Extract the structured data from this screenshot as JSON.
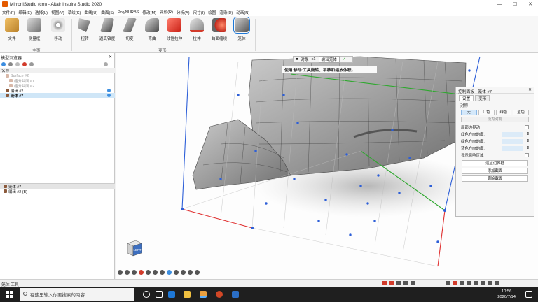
{
  "window": {
    "title": "Mirror.iStudio (cm) - Altair Inspire Studio 2020",
    "minimize": "—",
    "maximize": "☐",
    "close": "✕"
  },
  "menu": [
    "文件(F)",
    "编辑(E)",
    "选择(L)",
    "视图(V)",
    "草绘(K)",
    "曲线(U)",
    "曲面(S)",
    "PolyNURBS",
    "修改(M)",
    "变形(R)",
    "分析(A)",
    "尺寸(I)",
    "绘图",
    "渲染(D)",
    "动画(N)"
  ],
  "menu_active_index": 9,
  "ribbon": {
    "home_tools": [
      {
        "label": "文件",
        "icon": "file-icon"
      },
      {
        "label": "测量框",
        "icon": "measure-box-icon"
      },
      {
        "label": "移动",
        "icon": "move-icon"
      }
    ],
    "home_group": "主页",
    "deform_tools": [
      {
        "label": "扭转",
        "icon": "twist-icon"
      },
      {
        "label": "逼真锥度",
        "icon": "taper-icon"
      },
      {
        "label": "切变",
        "icon": "shear-icon"
      },
      {
        "label": "弯曲",
        "icon": "bend-icon"
      },
      {
        "label": "线性拉伸",
        "icon": "linear-stretch-icon"
      },
      {
        "label": "拉伸",
        "icon": "stretch-icon"
      },
      {
        "label": "曲面缠绕",
        "icon": "surface-wrap-icon"
      },
      {
        "label": "笼体",
        "icon": "cage-icon"
      }
    ],
    "deform_group": "变形"
  },
  "model_browser": {
    "title": "模型浏览器",
    "column": "名称",
    "tree": [
      {
        "label": "Surface #2",
        "muted": true,
        "indent": 1
      },
      {
        "label": "缩分曲面 #1",
        "muted": true,
        "indent": 2
      },
      {
        "label": "缩分曲面 #2",
        "muted": true,
        "indent": 2
      },
      {
        "label": "编辑 #2",
        "muted": false,
        "indent": 1,
        "dot": true
      },
      {
        "label": "笼体 #7",
        "muted": false,
        "indent": 1,
        "dot": true,
        "selected": true
      }
    ],
    "bottom_list": [
      {
        "label": "笼体 #7",
        "selected": true
      },
      {
        "label": "编辑 #2 (B)",
        "selected": false
      }
    ]
  },
  "viewport": {
    "tooltip": "使用'移动'工具旋转、平移和缩放体积。",
    "top_bar": {
      "label": "对象",
      "count": "x1",
      "edit": "编辑笼体",
      "ok": "✓"
    },
    "nav_cube_label": "LEFT"
  },
  "control_panel": {
    "title": "控制面板 - 笼体 #7",
    "tabs": [
      "设置",
      "变形"
    ],
    "symmetry_label": "对称",
    "symmetry_options": [
      "无",
      "红色",
      "绿色",
      "蓝色"
    ],
    "full_symmetry": "设为对称",
    "rows": [
      {
        "label": "局部边界动",
        "type": "checkbox"
      },
      {
        "label": "红色方向的度:",
        "type": "field",
        "value": "3"
      },
      {
        "label": "绿色方向的度:",
        "type": "field",
        "value": "3"
      },
      {
        "label": "蓝色方向的度:",
        "type": "field",
        "value": "3"
      },
      {
        "label": "显示影响区域",
        "type": "checkbox"
      }
    ],
    "actions": [
      "适应边界框",
      "添加截面",
      "删除截面"
    ]
  },
  "statusbar": {
    "text": "笼体 工具"
  },
  "taskbar": {
    "search_placeholder": "在这里输入你要搜索的内容",
    "time": "10:56",
    "date": "2020/7/14"
  },
  "colors": {
    "accent": "#1e78d7",
    "cage_red": "#e03030",
    "cage_green": "#2ea82e",
    "cage_blue": "#2d5fd8"
  }
}
